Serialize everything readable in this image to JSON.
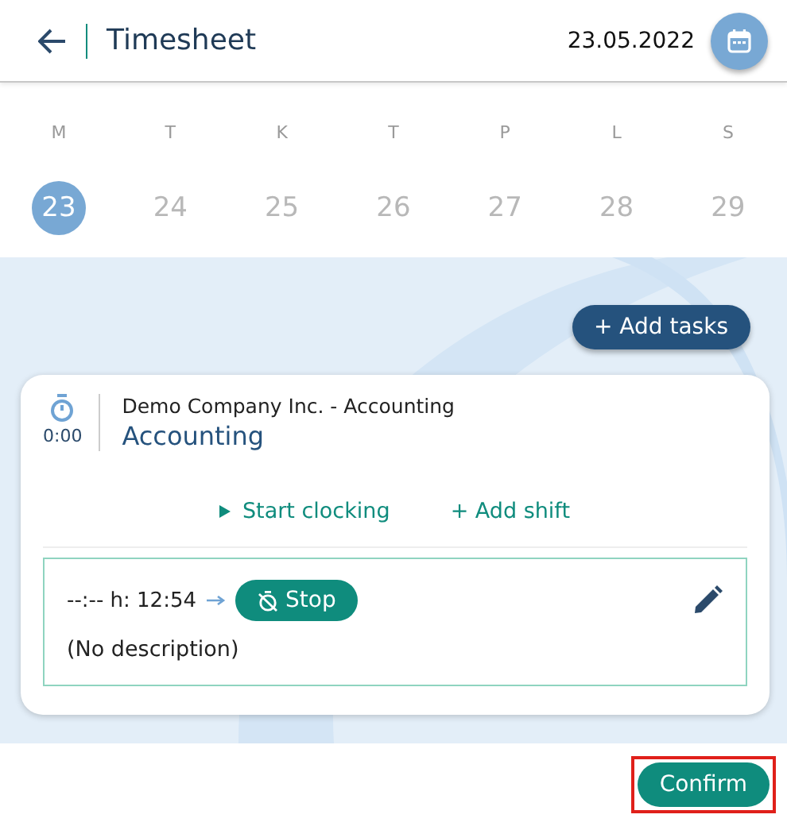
{
  "header": {
    "title": "Timesheet",
    "date": "23.05.2022"
  },
  "week": [
    {
      "weekday": "M",
      "day": "23",
      "selected": true
    },
    {
      "weekday": "T",
      "day": "24",
      "selected": false
    },
    {
      "weekday": "K",
      "day": "25",
      "selected": false
    },
    {
      "weekday": "T",
      "day": "26",
      "selected": false
    },
    {
      "weekday": "P",
      "day": "27",
      "selected": false
    },
    {
      "weekday": "L",
      "day": "28",
      "selected": false
    },
    {
      "weekday": "S",
      "day": "29",
      "selected": false
    }
  ],
  "add_tasks_button": "+ Add tasks",
  "task": {
    "duration": "0:00",
    "company": "Demo Company Inc. - Accounting",
    "name": "Accounting",
    "actions": [
      {
        "kind": "start",
        "label": "Start clocking"
      },
      {
        "kind": "add",
        "label": "+ Add shift"
      }
    ],
    "entry": {
      "time_range": "--:-- h: 12:54",
      "stop_label": "Stop",
      "description": "(No description)"
    }
  },
  "confirm": {
    "label": "Confirm",
    "highlighted": true
  }
}
